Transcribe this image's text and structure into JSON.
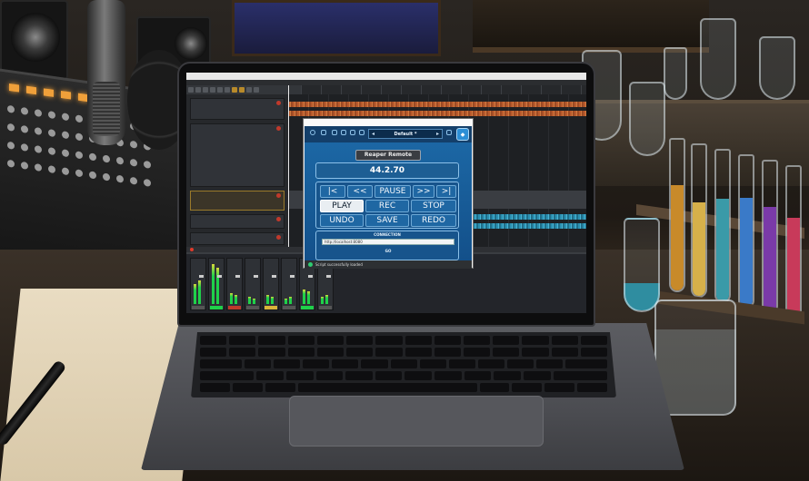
{
  "scene": {
    "description_colors": {
      "desk": "#2a231c",
      "accent_led": "#f0a03a"
    }
  },
  "daw": {
    "window_title": "",
    "menu": [],
    "tracks": [
      {
        "name": "",
        "selected": false
      },
      {
        "name": "",
        "selected": false
      },
      {
        "name": "",
        "selected": true
      },
      {
        "name": "",
        "selected": false
      },
      {
        "name": "",
        "selected": false
      }
    ],
    "mixer_strip_count": 8,
    "colors": {
      "orange_wave": "#b85a2c",
      "blue_wave": "#2a8fb0",
      "meter": "#1fd14a"
    }
  },
  "plugin": {
    "window_title": "",
    "preset": "Default *",
    "panel_title": "Reaper Remote",
    "position": "44.2.70",
    "transport": {
      "to_start": "|<",
      "rewind": "<<",
      "pause": "PAUSE",
      "forward": ">>",
      "to_end": ">|",
      "play": "PLAY",
      "rec": "REC",
      "stop": "STOP",
      "undo": "UNDO",
      "save": "SAVE",
      "redo": "REDO"
    },
    "connection": {
      "label": "CONNECTION",
      "url": "http://localhost:8080",
      "button": "GO"
    },
    "status": "Script successfully loaded",
    "colors": {
      "body": "#1d6aa8",
      "active_button": "#e9eef2",
      "status_dot": "#2ecc71"
    }
  }
}
